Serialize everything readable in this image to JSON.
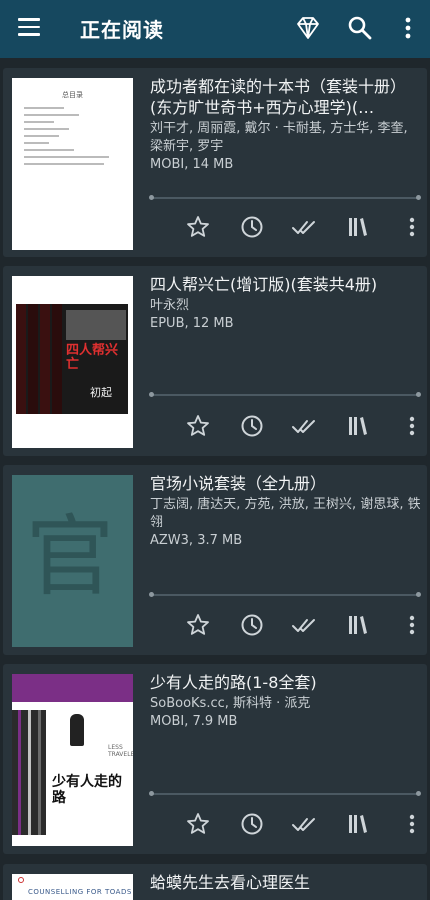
{
  "header": {
    "title": "正在阅读",
    "icons": [
      "menu-icon",
      "diamond-icon",
      "search-icon",
      "more-vert-icon"
    ]
  },
  "cover_texts": {
    "book1_cover": "总目录",
    "book2_cover_title": "四人帮兴亡",
    "book2_cover_sub": "初起",
    "book3_cover_glyph": "官",
    "book4_cover_title": "少有人走的路",
    "book4_cover_en": "LESS TRAVELED",
    "book5_cover": "COUNSELLING FOR TOADS"
  },
  "books": [
    {
      "title": "成功者都在读的十本书（套装十册）(东方旷世奇书+西方心理学)(…",
      "authors": "刘干才, 周丽霞, 戴尔 · 卡耐基, 方士华, 李奎, 梁新宇, 罗宇",
      "meta": "MOBI, 14 MB"
    },
    {
      "title": "四人帮兴亡(增订版)(套装共4册)",
      "authors": "叶永烈",
      "meta": "EPUB, 12 MB"
    },
    {
      "title": "官场小说套装（全九册）",
      "authors": "丁志阔, 唐达天, 方苑, 洪放, 王树兴, 谢思球, 铁翎",
      "meta": "AZW3, 3.7 MB"
    },
    {
      "title": "少有人走的路(1-8全套)",
      "authors": "SoBooKs.cc, 斯科特 · 派克",
      "meta": "MOBI, 7.9 MB"
    },
    {
      "title": "蛤蟆先生去看心理医生",
      "authors": "",
      "meta": ""
    }
  ],
  "colors": {
    "appbar": "#16485f",
    "background": "#1f272c",
    "card": "#29343b"
  }
}
